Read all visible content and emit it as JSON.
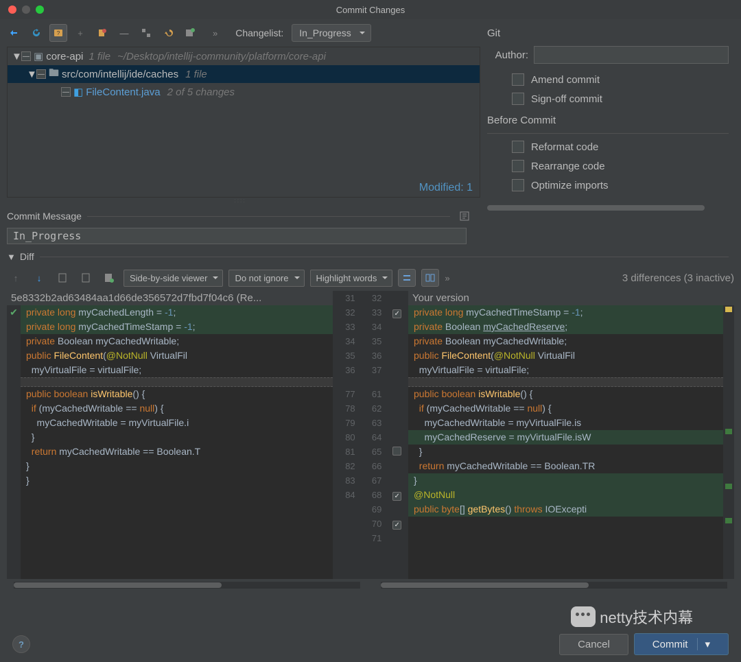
{
  "window": {
    "title": "Commit Changes"
  },
  "toolbar": {
    "changelist_label": "Changelist:",
    "changelist_value": "In_Progress"
  },
  "tree": {
    "root": {
      "name": "core-api",
      "files": "1 file",
      "path": "~/Desktop/intellij-community/platform/core-api"
    },
    "pkg": {
      "name": "src/com/intellij/ide/caches",
      "files": "1 file"
    },
    "file": {
      "name": "FileContent.java",
      "status": "2 of 5 changes"
    },
    "footer": "Modified: 1"
  },
  "commit_message": {
    "label": "Commit Message",
    "value": "In_Progress"
  },
  "git": {
    "header": "Git",
    "author_label": "Author:",
    "author_value": "",
    "amend_label": "Amend commit",
    "signoff_label": "Sign-off commit",
    "before_label": "Before Commit",
    "reformat_label": "Reformat code",
    "rearrange_label": "Rearrange code",
    "optimize_label": "Optimize imports"
  },
  "diff": {
    "header": "Diff",
    "viewer_mode": "Side-by-side viewer",
    "ignore_mode": "Do not ignore",
    "highlight_mode": "Highlight words",
    "status": "3 differences (3 inactive)",
    "left_title": "5e8332b2ad63484aa1d66de356572d7fbd7f04c6 (Re...",
    "right_title": "Your version",
    "left_gutter_a": [
      "31",
      "32",
      "33",
      "34",
      "35",
      "36"
    ],
    "left_gutter_b": [
      "77",
      "78",
      "79",
      "80",
      "81",
      "82",
      "83",
      "84"
    ],
    "right_gutter_a_l": [
      "32",
      "33",
      "34",
      "35",
      "36",
      "37"
    ],
    "right_gutter_a_chk": [
      "",
      "on",
      "",
      "",
      "",
      ""
    ],
    "right_gutter_b_l": [
      "61",
      "62",
      "63",
      "64",
      "65",
      "66",
      "67",
      "68",
      "69",
      "70",
      "71"
    ],
    "right_gutter_b_chk": [
      "",
      "",
      "",
      "",
      "off",
      "",
      "",
      "on",
      "",
      "on",
      ""
    ]
  },
  "code_left_a": [
    {
      "cls": "mod",
      "html": "<span class='kw'>private</span> <span class='kw'>long</span> myCachedLength = <span class='num'>-1</span>;"
    },
    {
      "cls": "mod",
      "html": "<span class='kw'>private</span> <span class='kw'>long</span> myCachedTimeStamp = <span class='num'>-1</span>;"
    },
    {
      "cls": "",
      "html": "<span class='kw'>private</span> <span class='ty'>Boolean</span> myCachedWritable;"
    },
    {
      "cls": "",
      "html": ""
    },
    {
      "cls": "",
      "html": "<span class='kw'>public</span> <span class='fn'>FileContent</span>(<span class='ann'>@NotNull</span> VirtualFil"
    },
    {
      "cls": "",
      "html": "  myVirtualFile = virtualFile;"
    }
  ],
  "code_left_b": [
    {
      "cls": "",
      "html": "<span class='kw'>public</span> <span class='kw'>boolean</span> <span class='fn'>isWritable</span>() {"
    },
    {
      "cls": "",
      "html": "  <span class='kw'>if</span> (myCachedWritable == <span class='kw'>null</span>) {"
    },
    {
      "cls": "",
      "html": "    myCachedWritable = myVirtualFile.i"
    },
    {
      "cls": "",
      "html": "  }"
    },
    {
      "cls": "",
      "html": "  <span class='kw'>return</span> myCachedWritable == Boolean.<span class='ty'>T</span>"
    },
    {
      "cls": "",
      "html": "}"
    },
    {
      "cls": "",
      "html": "}"
    }
  ],
  "code_right_a": [
    {
      "cls": "mod",
      "html": "<span class='kw'>private</span> <span class='kw'>long</span> myCachedTimeStamp = <span class='num'>-1</span>;"
    },
    {
      "cls": "add",
      "html": "<span class='kw'>private</span> <span class='ty'>Boolean</span> <span class='und'>myCachedReserve</span>;"
    },
    {
      "cls": "",
      "html": "<span class='kw'>private</span> <span class='ty'>Boolean</span> myCachedWritable;"
    },
    {
      "cls": "",
      "html": ""
    },
    {
      "cls": "",
      "html": "<span class='kw'>public</span> <span class='fn'>FileContent</span>(<span class='ann'>@NotNull</span> VirtualFil"
    },
    {
      "cls": "",
      "html": "  myVirtualFile = virtualFile;"
    }
  ],
  "code_right_b": [
    {
      "cls": "",
      "html": "<span class='kw'>public</span> <span class='kw'>boolean</span> <span class='fn'>isWritable</span>() {"
    },
    {
      "cls": "",
      "html": "  <span class='kw'>if</span> (myCachedWritable == <span class='kw'>null</span>) {"
    },
    {
      "cls": "",
      "html": "    myCachedWritable = myVirtualFile.is"
    },
    {
      "cls": "add",
      "html": "    myCachedReserve = myVirtualFile.isW"
    },
    {
      "cls": "",
      "html": "  }"
    },
    {
      "cls": "",
      "html": "  <span class='kw'>return</span> myCachedWritable == Boolean.<span class='ty'>TR</span>"
    },
    {
      "cls": "add",
      "html": "}"
    },
    {
      "cls": "add",
      "html": ""
    },
    {
      "cls": "add",
      "html": "<span class='ann'>@NotNull</span>"
    },
    {
      "cls": "add",
      "html": "<span class='kw'>public</span> <span class='kw'>byte</span>[] <span class='fn'>getBytes</span>() <span class='kw'>throws</span> IOExcepti"
    }
  ],
  "buttons": {
    "cancel": "Cancel",
    "commit": "Commit"
  },
  "watermark": "netty技术内幕"
}
